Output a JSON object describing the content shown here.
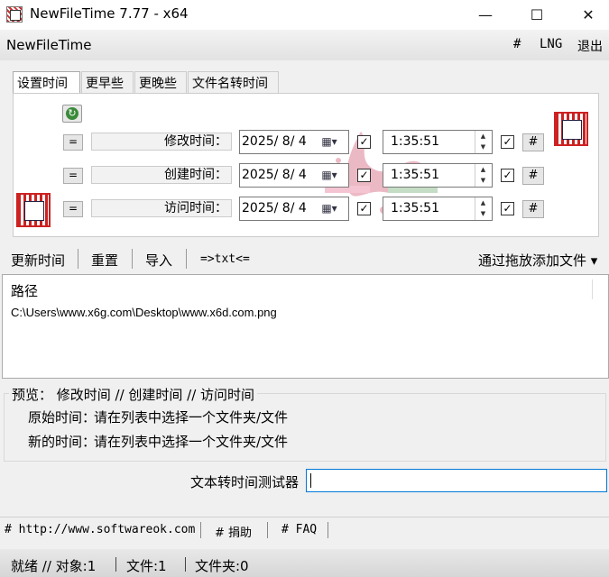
{
  "window": {
    "title": "NewFileTime 7.77 - x64",
    "min_icon": "minimize-icon",
    "max_icon": "maximize-icon",
    "close_icon": "close-icon"
  },
  "menubar": {
    "app_name": "NewFileTime",
    "hash": "#",
    "lng": "LNG",
    "exit": "退出"
  },
  "tabs": [
    {
      "label": "设置时间",
      "active": true
    },
    {
      "label": "更早些",
      "active": false
    },
    {
      "label": "更晚些",
      "active": false
    },
    {
      "label": "文件名转时间",
      "active": false
    }
  ],
  "time_rows": [
    {
      "eq": "=",
      "label": "修改时间：",
      "date": "2025/ 8/ 4",
      "time": "1:35:51",
      "checked_date": true,
      "checked_time": true,
      "hash": "#"
    },
    {
      "eq": "=",
      "label": "创建时间：",
      "date": "2025/ 8/ 4",
      "time": "1:35:51",
      "checked_date": true,
      "checked_time": true,
      "hash": "#"
    },
    {
      "eq": "=",
      "label": "访问时间：",
      "date": "2025/ 8/ 4",
      "time": "1:35:51",
      "checked_date": true,
      "checked_time": true,
      "hash": "#"
    }
  ],
  "toolbar": {
    "update": "更新时间",
    "reset": "重置",
    "import": "导入",
    "txt": "=>txt<=",
    "drag_add": "通过拖放添加文件 ▾"
  },
  "filelist": {
    "column": "路径",
    "rows": [
      "C:\\Users\\www.x6g.com\\Desktop\\www.x6d.com.png"
    ]
  },
  "preview": {
    "legend": "预览：  修改时间   //  创建时间   //  访问时间",
    "original_label": "原始时间：",
    "original_value": "请在列表中选择一个文件夹/文件",
    "new_label": "新的时间：",
    "new_value": "请在列表中选择一个文件夹/文件"
  },
  "tester": {
    "label": "文本转时间测试器",
    "value": ""
  },
  "links": {
    "site": "# http://www.softwareok.com",
    "donate": "# 捐助",
    "faq": "# FAQ"
  },
  "status": {
    "ready": "就绪 // 对象:1",
    "files": "文件:1",
    "folders": "文件夹:0"
  },
  "colors": {
    "accent": "#0078d7",
    "icon_red": "#cc2222"
  }
}
